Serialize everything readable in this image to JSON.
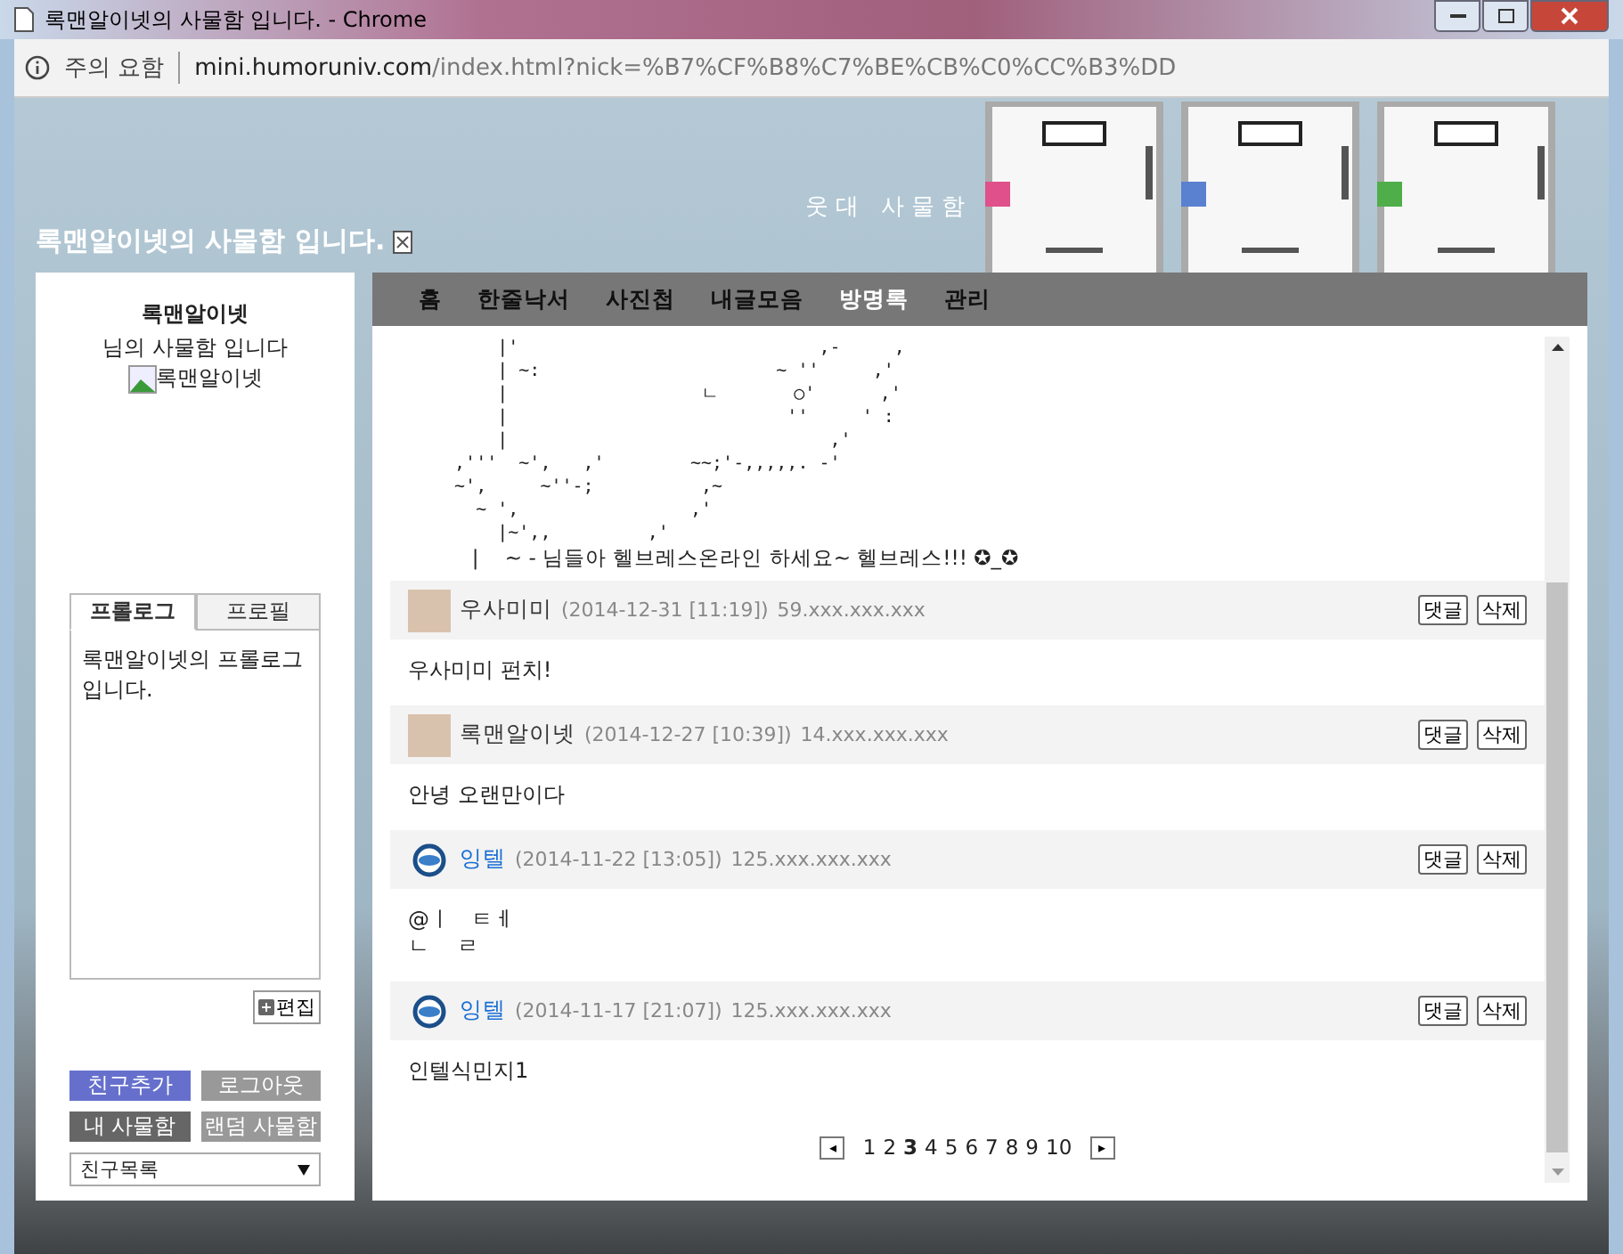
{
  "window": {
    "title": "록맨알이넷의 사물함 입니다. - Chrome"
  },
  "address_bar": {
    "security": "주의 요함",
    "host": "mini.humoruniv.com",
    "path": "/index.html?nick=%B7%CF%B8%C7%BE%CB%C0%CC%B3%DD"
  },
  "banner": {
    "title": "록맨알이넷의 사물함 입니다.",
    "logo": "웃대 사물함"
  },
  "profile": {
    "nickname": "록맨알이넷",
    "subtitle": "님의 사물함 입니다",
    "image_alt": "록맨알이넷",
    "tabs": [
      {
        "label": "프롤로그",
        "selected": true
      },
      {
        "label": "프로필",
        "selected": false
      }
    ],
    "prologue": "록맨알이넷의 프롤로그 입니다.",
    "edit_button": "편집",
    "buttons": [
      {
        "label": "친구추가",
        "color": "#6670cc"
      },
      {
        "label": "로그아웃",
        "color": "#999999"
      },
      {
        "label": "내 사물함",
        "color": "#666666"
      },
      {
        "label": "랜덤 사물함",
        "color": "#999999"
      }
    ],
    "friends_select": "친구목록"
  },
  "nav": [
    {
      "label": "홈",
      "selected": false
    },
    {
      "label": "한줄낙서",
      "selected": false
    },
    {
      "label": "사진첩",
      "selected": false
    },
    {
      "label": "내글모음",
      "selected": false
    },
    {
      "label": "방명록",
      "selected": true
    },
    {
      "label": "관리",
      "selected": false
    }
  ],
  "ascii_art": [
    "      |'                            ,-     ,",
    "      | ~:                      ~ ''     ,'",
    "      |                  ㄴ       ○'      ,'",
    "      |                          ''     ' :",
    "      |                              ,'",
    "  ,'''  ~',   ,'        ~~;'-,,,,,. -'",
    "  ~',     ~''-;          ,~",
    "    ~ ',                ,'",
    "      |~',,         ,'"
  ],
  "ascii_caption": "      |    ~ - 님들아 헬브레스온라인 하세요~ 헬브레스!!! ✪_✪",
  "posts": [
    {
      "kind": "picture",
      "name": "우사미미",
      "color": "#333333",
      "date": "(2014-12-31 [11:19])",
      "ip": "59.xxx.xxx.xxx",
      "reply": "댓글",
      "delete": "삭제",
      "body": [
        "우사미미 펀치!"
      ]
    },
    {
      "kind": "picture",
      "name": "록맨알이넷",
      "color": "#333333",
      "date": "(2014-12-27 [10:39])",
      "ip": "14.xxx.xxx.xxx",
      "reply": "댓글",
      "delete": "삭제",
      "body": [
        "안녕 오랜만이다"
      ]
    },
    {
      "kind": "logo",
      "name": "잉텔",
      "color": "#1a6fd6",
      "date": "(2014-11-22 [13:05])",
      "ip": "125.xxx.xxx.xxx",
      "reply": "댓글",
      "delete": "삭제",
      "body": [
        "@ㅣ   ㅌㅔ",
        "ㄴ    ㄹ"
      ]
    },
    {
      "kind": "logo",
      "name": "잉텔",
      "color": "#1a6fd6",
      "date": "(2014-11-17 [21:07])",
      "ip": "125.xxx.xxx.xxx",
      "reply": "댓글",
      "delete": "삭제",
      "body": [
        "인텔식민지1"
      ]
    }
  ],
  "pagination": {
    "prev": "◂",
    "next": "▸",
    "pages": [
      {
        "label": "1",
        "selected": false
      },
      {
        "label": "2",
        "selected": false
      },
      {
        "label": "3",
        "selected": true
      },
      {
        "label": "4",
        "selected": false
      },
      {
        "label": "5",
        "selected": false
      },
      {
        "label": "6",
        "selected": false
      },
      {
        "label": "7",
        "selected": false
      },
      {
        "label": "8",
        "selected": false
      },
      {
        "label": "9",
        "selected": false
      },
      {
        "label": "10",
        "selected": false
      }
    ]
  }
}
